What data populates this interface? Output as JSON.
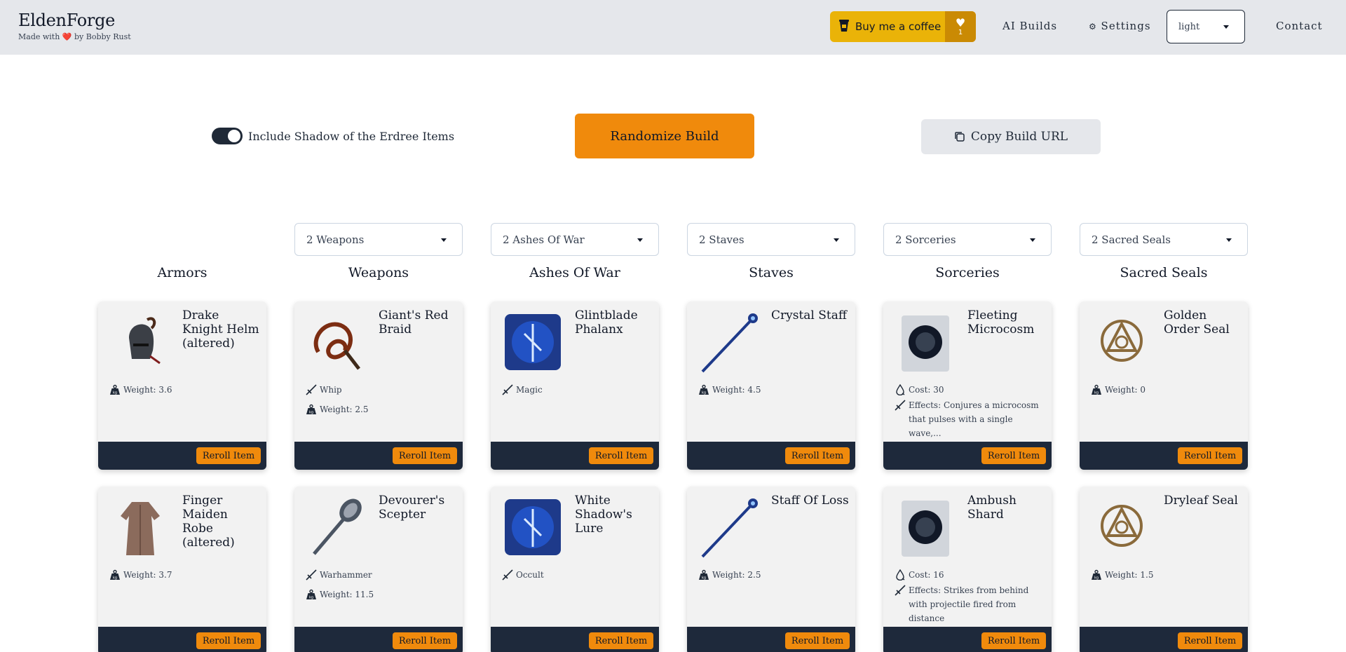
{
  "header": {
    "brand_title": "EldenForge",
    "brand_sub_pre": "Made with",
    "brand_sub_post": "by Bobby Rust",
    "coffee_label": "Buy me a coffee",
    "coffee_count": "1",
    "nav_ai": "AI Builds",
    "nav_settings": "Settings",
    "theme_value": "light",
    "nav_contact": "Contact"
  },
  "controls": {
    "toggle_label": "Include Shadow of the Erdree Items",
    "toggle_on": true,
    "randomize_label": "Randomize Build",
    "copy_label": "Copy Build URL"
  },
  "colors": {
    "accent": "#f08a0c",
    "coffee": "#eab308",
    "card_footer": "#1e293b",
    "card_bg": "#f2f2f2"
  },
  "columns": [
    {
      "heading": "Armors",
      "select": "",
      "cards": [
        {
          "title": "Drake Knight Helm (altered)",
          "icon": "helm-icon",
          "stats": [
            {
              "icon": "weight-icon",
              "text": "Weight: 3.6"
            }
          ]
        },
        {
          "title": "Finger Maiden Robe (altered)",
          "icon": "robe-icon",
          "stats": [
            {
              "icon": "weight-icon",
              "text": "Weight: 3.7"
            }
          ]
        }
      ]
    },
    {
      "heading": "Weapons",
      "select": "2 Weapons",
      "cards": [
        {
          "title": "Giant's Red Braid",
          "icon": "whip-icon",
          "stats": [
            {
              "icon": "sword-icon",
              "text": "Whip"
            },
            {
              "icon": "weight-icon",
              "text": "Weight: 2.5"
            }
          ]
        },
        {
          "title": "Devourer's Scepter",
          "icon": "hammer-icon",
          "stats": [
            {
              "icon": "sword-icon",
              "text": "Warhammer"
            },
            {
              "icon": "weight-icon",
              "text": "Weight: 11.5"
            }
          ]
        }
      ]
    },
    {
      "heading": "Ashes Of War",
      "select": "2 Ashes Of War",
      "cards": [
        {
          "title": "Glintblade Phalanx",
          "icon": "ash-icon",
          "stats": [
            {
              "icon": "sword-icon",
              "text": "Magic"
            }
          ]
        },
        {
          "title": "White Shadow's Lure",
          "icon": "ash-icon",
          "stats": [
            {
              "icon": "sword-icon",
              "text": "Occult"
            }
          ]
        }
      ]
    },
    {
      "heading": "Staves",
      "select": "2 Staves",
      "cards": [
        {
          "title": "Crystal Staff",
          "icon": "staff-icon",
          "stats": [
            {
              "icon": "weight-icon",
              "text": "Weight: 4.5"
            }
          ]
        },
        {
          "title": "Staff Of Loss",
          "icon": "staff-icon",
          "stats": [
            {
              "icon": "weight-icon",
              "text": "Weight: 2.5"
            }
          ]
        }
      ]
    },
    {
      "heading": "Sorceries",
      "select": "2 Sorceries",
      "cards": [
        {
          "title": "Fleeting Microcosm",
          "icon": "sorcery-icon",
          "stats": [
            {
              "icon": "drop-icon",
              "text": "Cost: 30"
            },
            {
              "icon": "sword-icon",
              "text": "Effects: Conjures a microcosm that pulses with a single wave,..."
            }
          ]
        },
        {
          "title": "Ambush Shard",
          "icon": "sorcery-icon",
          "stats": [
            {
              "icon": "drop-icon",
              "text": "Cost: 16"
            },
            {
              "icon": "sword-icon",
              "text": "Effects: Strikes from behind with projectile fired from distance"
            }
          ]
        }
      ]
    },
    {
      "heading": "Sacred Seals",
      "select": "2 Sacred Seals",
      "cards": [
        {
          "title": "Golden Order Seal",
          "icon": "seal-icon",
          "stats": [
            {
              "icon": "weight-icon",
              "text": "Weight: 0"
            }
          ]
        },
        {
          "title": "Dryleaf Seal",
          "icon": "seal-icon",
          "stats": [
            {
              "icon": "weight-icon",
              "text": "Weight: 1.5"
            }
          ]
        }
      ]
    }
  ],
  "reroll_label": "Reroll Item"
}
